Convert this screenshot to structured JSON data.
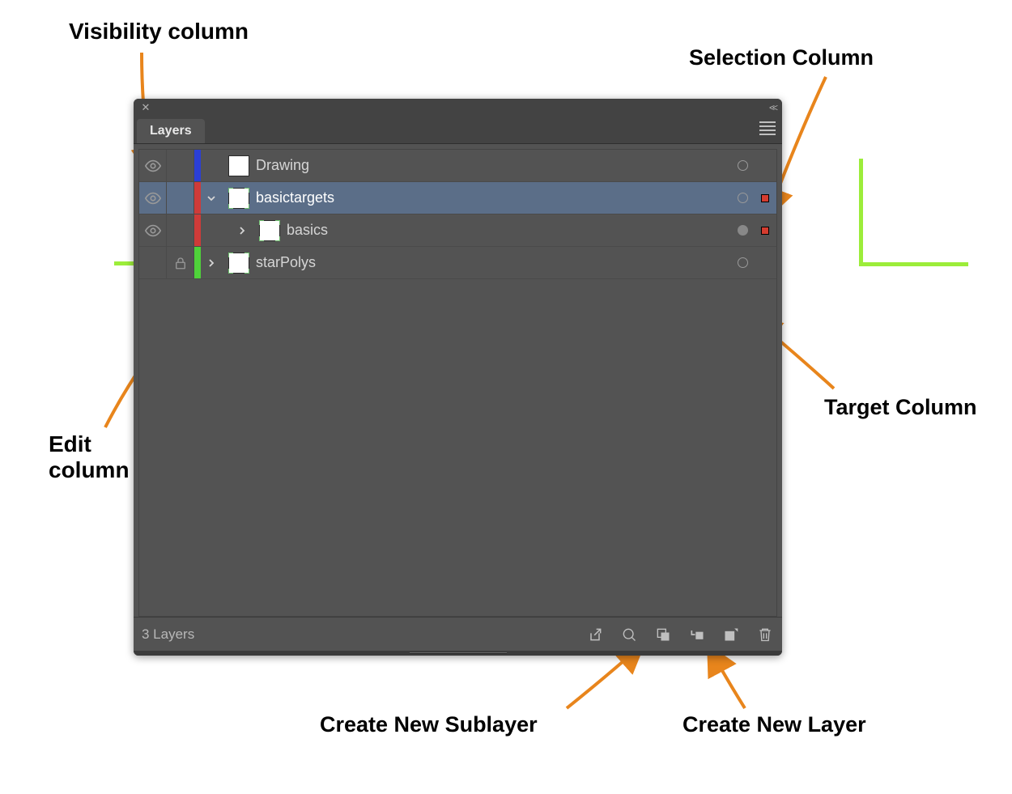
{
  "annotations": {
    "visibility": "Visibility column",
    "edit": "Edit\ncolumn",
    "selection": "Selection Column",
    "target": "Target Column",
    "newSublayer": "Create New Sublayer",
    "newLayer": "Create New Layer"
  },
  "panel": {
    "tab_label": "Layers",
    "footer_status": "3 Layers"
  },
  "layers": [
    {
      "name": "Drawing",
      "visible": true,
      "locked": false,
      "color": "#2b3fd6",
      "indent": 0,
      "disclosure": "none",
      "selected": false,
      "target_filled": false,
      "selection_sq": false
    },
    {
      "name": "basictargets",
      "visible": true,
      "locked": false,
      "color": "#cf3b39",
      "indent": 0,
      "disclosure": "open",
      "selected": true,
      "target_filled": false,
      "selection_sq": true
    },
    {
      "name": "basics",
      "visible": true,
      "locked": false,
      "color": "#cf3b39",
      "indent": 1,
      "disclosure": "closed",
      "selected": false,
      "target_filled": true,
      "selection_sq": true
    },
    {
      "name": "starPolys",
      "visible": false,
      "locked": true,
      "color": "#4fd23a",
      "indent": 0,
      "disclosure": "closed",
      "selected": false,
      "target_filled": false,
      "selection_sq": false
    }
  ]
}
